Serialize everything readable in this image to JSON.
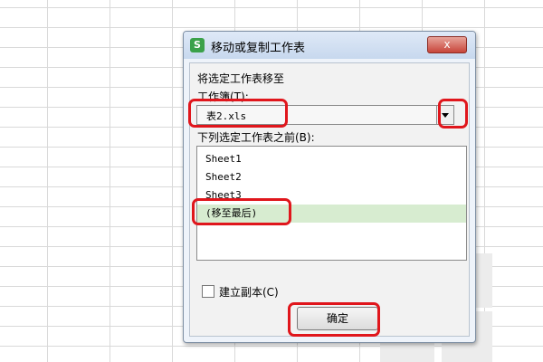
{
  "dialog": {
    "app_icon": "S",
    "title": "移动或复制工作表",
    "close_label": "x",
    "move_selected_label": "将选定工作表移至",
    "workbook_label": "工作簿(T):",
    "workbook_value": "表2.xls",
    "before_sheet_label": "下列选定工作表之前(B):",
    "sheets": [
      "Sheet1",
      "Sheet2",
      "Sheet3",
      "(移至最后)"
    ],
    "selected_sheet_index": 3,
    "create_copy_label": "建立副本(C)",
    "create_copy_checked": false,
    "ok_label": "确定"
  },
  "colors": {
    "annotation": "#e0161c",
    "selection": "#d7ecd0",
    "app_icon": "#3aa14a"
  },
  "icons": [
    "app-s-icon",
    "close-icon",
    "dropdown-arrow-icon"
  ]
}
